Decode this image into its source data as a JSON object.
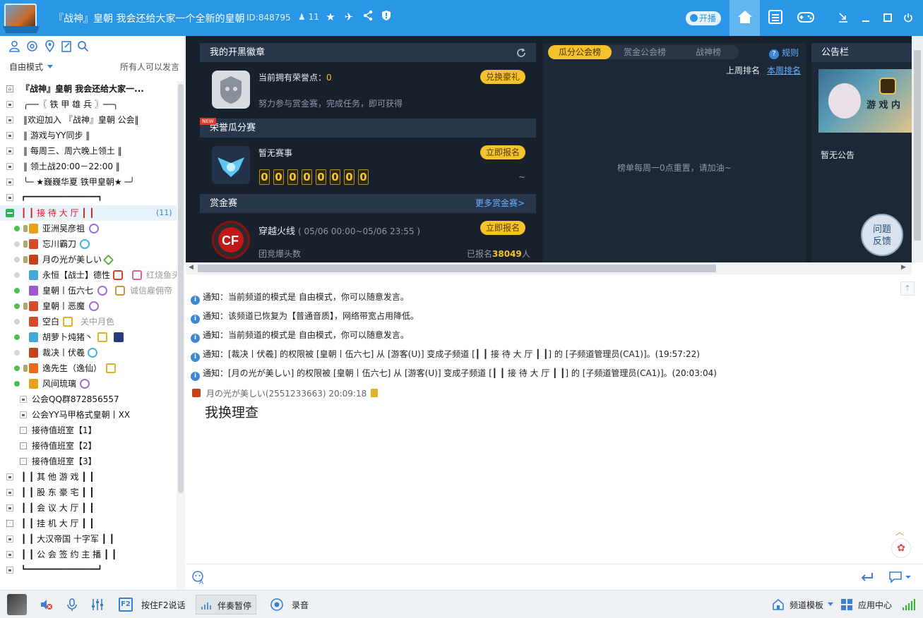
{
  "titlebar": {
    "channel_title": "『战神』皇朝 我会还给大家一个全新的皇朝",
    "channel_id": "ID:848795",
    "user_count": "11",
    "kaibo_label": "开播",
    "accent": "#2a97e6"
  },
  "left": {
    "mode_label": "自由模式",
    "speak_permission": "所有人可以发言",
    "tree": [
      {
        "label": "『战神』皇朝 我会还给大家一...",
        "kind": "root"
      },
      {
        "label": "╭──〖 铁 甲 雄 兵 〗──╮",
        "kind": "channel"
      },
      {
        "label": "‖欢迎加入 『战神』皇朝 公会‖",
        "kind": "channel"
      },
      {
        "label": "‖      游戏与YY同步      ‖",
        "kind": "channel"
      },
      {
        "label": "‖   每周三、周六晚上领土   ‖",
        "kind": "channel"
      },
      {
        "label": "‖    领土战20:00－22:00    ‖",
        "kind": "channel"
      },
      {
        "label": "╰─ ★巍巍华夏 铁甲皇朝★ ─╯",
        "kind": "channel"
      },
      {
        "label": "┏━━━━━━━━━━━━━━━━━┓",
        "kind": "channel"
      },
      {
        "label": "┃ ┃    接 待 大 厅     ┃ ┃",
        "kind": "active",
        "count": "(11)"
      }
    ],
    "users": [
      {
        "name": "亚洲吴彦祖",
        "online": true
      },
      {
        "name": "忘川霸刀",
        "online": false
      },
      {
        "name": "月の光が美しい",
        "online": false
      },
      {
        "name": "永恒【战士】德性",
        "online": false,
        "extra": "红烧鱼头"
      },
      {
        "name": "皇朝丨伍六七",
        "online": true,
        "extra": "诚信雇佣帝"
      },
      {
        "name": "皇朝丨恶魔",
        "online": true
      },
      {
        "name": "空白",
        "online": false,
        "extra": "关中月色"
      },
      {
        "name": "胡萝卜炖猪丶",
        "online": true
      },
      {
        "name": "裁决丨伏羲",
        "online": false
      },
      {
        "name": "逸先生（逸仙）",
        "online": true
      },
      {
        "name": "风间琉璃",
        "online": true
      }
    ],
    "subchannels": [
      "公会QQ群872856557",
      "公会YY马甲格式皇朝丨XX",
      "接待值班室【1】",
      "接待值班室【2】",
      "接待值班室【3】"
    ],
    "more_channels": [
      "┃ ┃     其 他 游 戏     ┃ ┃",
      "┃ ┃     股 东 豪 宅     ┃ ┃",
      "┃ ┃     会 议 大 厅     ┃ ┃",
      "┃ ┃     挂 机 大 厅     ┃ ┃",
      "┃ ┃  大汉帝国   十字军  ┃ ┃",
      "┃ ┃  公 会 签 约 主 播  ┃ ┃",
      "┗━━━━━━━━━━━━━━━━━┛"
    ]
  },
  "badge": {
    "header": "我的开黑徽章",
    "honor_label": "当前拥有荣誉点：",
    "honor_value": "0",
    "redeem_button": "兑换豪礼",
    "desc": "努力参与赏金赛，完成任务，即可获得"
  },
  "honor_match": {
    "new_tag": "NEW",
    "header": "荣誉瓜分赛",
    "status": "暂无赛事",
    "signup_button": "立即报名",
    "digits": [
      "0",
      "0",
      "0",
      "0",
      "0",
      "0",
      "0",
      "0"
    ],
    "tilde": "~"
  },
  "bounty": {
    "header": "赏金赛",
    "more_link": "更多赏金赛>",
    "game": "穿越火线",
    "time": "( 05/06 00:00~05/06 23:55 )",
    "signup_button": "立即报名",
    "mode": "团竞爆头数",
    "registered_label": "已报名",
    "registered_count": "38049",
    "registered_unit": "人"
  },
  "ranking": {
    "tabs": [
      "瓜分公会榜",
      "赏金公会榜",
      "战神榜"
    ],
    "rules_link": "规则",
    "last_week": "上周排名",
    "this_week": "本周排名",
    "empty_note": "榜单每周一0点重置，请加油~"
  },
  "bulletin": {
    "header": "公告栏",
    "banner_text": "游 戏 内",
    "empty": "暂无公告"
  },
  "feedback": {
    "line1": "问题",
    "line2": "反馈"
  },
  "chat": {
    "notices": [
      "通知：当前频道的模式是 自由模式，你可以随意发言。",
      "通知：该频道已恢复为【普通音质】，网络带宽占用降低。",
      "通知：当前频道的模式是 自由模式，你可以随意发言。",
      "通知：[裁决丨伏羲] 的权限被 [皇朝丨伍六七] 从 [游客(U)] 变成子频道 [┃ ┃     接 待 大 厅     ┃ ┃] 的 [子频道管理员(CA1)]。(19:57:22)",
      "通知：[月の光が美しい] 的权限被 [皇朝丨伍六七] 从 [游客(U)] 变成子频道 [┃ ┃     接 待 大 厅     ┃ ┃] 的 [子频道管理员(CA1)]。(20:03:04)"
    ],
    "message_header": "月の光が美しい(2551233663) 20:09:18",
    "message_body": "我换理查"
  },
  "bottom": {
    "ptt_label": "按住F2说话",
    "accompany_label": "伴奏暂停",
    "record_label": "录音",
    "template_label": "频道模板",
    "appcenter_label": "应用中心"
  }
}
